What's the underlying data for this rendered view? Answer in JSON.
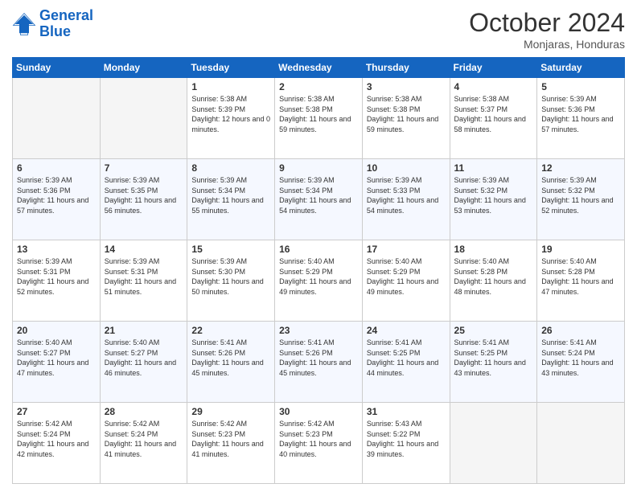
{
  "logo": {
    "line1": "General",
    "line2": "Blue"
  },
  "header": {
    "month": "October 2024",
    "location": "Monjaras, Honduras"
  },
  "weekdays": [
    "Sunday",
    "Monday",
    "Tuesday",
    "Wednesday",
    "Thursday",
    "Friday",
    "Saturday"
  ],
  "weeks": [
    [
      {
        "day": "",
        "sunrise": "",
        "sunset": "",
        "daylight": ""
      },
      {
        "day": "",
        "sunrise": "",
        "sunset": "",
        "daylight": ""
      },
      {
        "day": "1",
        "sunrise": "Sunrise: 5:38 AM",
        "sunset": "Sunset: 5:39 PM",
        "daylight": "Daylight: 12 hours and 0 minutes."
      },
      {
        "day": "2",
        "sunrise": "Sunrise: 5:38 AM",
        "sunset": "Sunset: 5:38 PM",
        "daylight": "Daylight: 11 hours and 59 minutes."
      },
      {
        "day": "3",
        "sunrise": "Sunrise: 5:38 AM",
        "sunset": "Sunset: 5:38 PM",
        "daylight": "Daylight: 11 hours and 59 minutes."
      },
      {
        "day": "4",
        "sunrise": "Sunrise: 5:38 AM",
        "sunset": "Sunset: 5:37 PM",
        "daylight": "Daylight: 11 hours and 58 minutes."
      },
      {
        "day": "5",
        "sunrise": "Sunrise: 5:39 AM",
        "sunset": "Sunset: 5:36 PM",
        "daylight": "Daylight: 11 hours and 57 minutes."
      }
    ],
    [
      {
        "day": "6",
        "sunrise": "Sunrise: 5:39 AM",
        "sunset": "Sunset: 5:36 PM",
        "daylight": "Daylight: 11 hours and 57 minutes."
      },
      {
        "day": "7",
        "sunrise": "Sunrise: 5:39 AM",
        "sunset": "Sunset: 5:35 PM",
        "daylight": "Daylight: 11 hours and 56 minutes."
      },
      {
        "day": "8",
        "sunrise": "Sunrise: 5:39 AM",
        "sunset": "Sunset: 5:34 PM",
        "daylight": "Daylight: 11 hours and 55 minutes."
      },
      {
        "day": "9",
        "sunrise": "Sunrise: 5:39 AM",
        "sunset": "Sunset: 5:34 PM",
        "daylight": "Daylight: 11 hours and 54 minutes."
      },
      {
        "day": "10",
        "sunrise": "Sunrise: 5:39 AM",
        "sunset": "Sunset: 5:33 PM",
        "daylight": "Daylight: 11 hours and 54 minutes."
      },
      {
        "day": "11",
        "sunrise": "Sunrise: 5:39 AM",
        "sunset": "Sunset: 5:32 PM",
        "daylight": "Daylight: 11 hours and 53 minutes."
      },
      {
        "day": "12",
        "sunrise": "Sunrise: 5:39 AM",
        "sunset": "Sunset: 5:32 PM",
        "daylight": "Daylight: 11 hours and 52 minutes."
      }
    ],
    [
      {
        "day": "13",
        "sunrise": "Sunrise: 5:39 AM",
        "sunset": "Sunset: 5:31 PM",
        "daylight": "Daylight: 11 hours and 52 minutes."
      },
      {
        "day": "14",
        "sunrise": "Sunrise: 5:39 AM",
        "sunset": "Sunset: 5:31 PM",
        "daylight": "Daylight: 11 hours and 51 minutes."
      },
      {
        "day": "15",
        "sunrise": "Sunrise: 5:39 AM",
        "sunset": "Sunset: 5:30 PM",
        "daylight": "Daylight: 11 hours and 50 minutes."
      },
      {
        "day": "16",
        "sunrise": "Sunrise: 5:40 AM",
        "sunset": "Sunset: 5:29 PM",
        "daylight": "Daylight: 11 hours and 49 minutes."
      },
      {
        "day": "17",
        "sunrise": "Sunrise: 5:40 AM",
        "sunset": "Sunset: 5:29 PM",
        "daylight": "Daylight: 11 hours and 49 minutes."
      },
      {
        "day": "18",
        "sunrise": "Sunrise: 5:40 AM",
        "sunset": "Sunset: 5:28 PM",
        "daylight": "Daylight: 11 hours and 48 minutes."
      },
      {
        "day": "19",
        "sunrise": "Sunrise: 5:40 AM",
        "sunset": "Sunset: 5:28 PM",
        "daylight": "Daylight: 11 hours and 47 minutes."
      }
    ],
    [
      {
        "day": "20",
        "sunrise": "Sunrise: 5:40 AM",
        "sunset": "Sunset: 5:27 PM",
        "daylight": "Daylight: 11 hours and 47 minutes."
      },
      {
        "day": "21",
        "sunrise": "Sunrise: 5:40 AM",
        "sunset": "Sunset: 5:27 PM",
        "daylight": "Daylight: 11 hours and 46 minutes."
      },
      {
        "day": "22",
        "sunrise": "Sunrise: 5:41 AM",
        "sunset": "Sunset: 5:26 PM",
        "daylight": "Daylight: 11 hours and 45 minutes."
      },
      {
        "day": "23",
        "sunrise": "Sunrise: 5:41 AM",
        "sunset": "Sunset: 5:26 PM",
        "daylight": "Daylight: 11 hours and 45 minutes."
      },
      {
        "day": "24",
        "sunrise": "Sunrise: 5:41 AM",
        "sunset": "Sunset: 5:25 PM",
        "daylight": "Daylight: 11 hours and 44 minutes."
      },
      {
        "day": "25",
        "sunrise": "Sunrise: 5:41 AM",
        "sunset": "Sunset: 5:25 PM",
        "daylight": "Daylight: 11 hours and 43 minutes."
      },
      {
        "day": "26",
        "sunrise": "Sunrise: 5:41 AM",
        "sunset": "Sunset: 5:24 PM",
        "daylight": "Daylight: 11 hours and 43 minutes."
      }
    ],
    [
      {
        "day": "27",
        "sunrise": "Sunrise: 5:42 AM",
        "sunset": "Sunset: 5:24 PM",
        "daylight": "Daylight: 11 hours and 42 minutes."
      },
      {
        "day": "28",
        "sunrise": "Sunrise: 5:42 AM",
        "sunset": "Sunset: 5:24 PM",
        "daylight": "Daylight: 11 hours and 41 minutes."
      },
      {
        "day": "29",
        "sunrise": "Sunrise: 5:42 AM",
        "sunset": "Sunset: 5:23 PM",
        "daylight": "Daylight: 11 hours and 41 minutes."
      },
      {
        "day": "30",
        "sunrise": "Sunrise: 5:42 AM",
        "sunset": "Sunset: 5:23 PM",
        "daylight": "Daylight: 11 hours and 40 minutes."
      },
      {
        "day": "31",
        "sunrise": "Sunrise: 5:43 AM",
        "sunset": "Sunset: 5:22 PM",
        "daylight": "Daylight: 11 hours and 39 minutes."
      },
      {
        "day": "",
        "sunrise": "",
        "sunset": "",
        "daylight": ""
      },
      {
        "day": "",
        "sunrise": "",
        "sunset": "",
        "daylight": ""
      }
    ]
  ]
}
